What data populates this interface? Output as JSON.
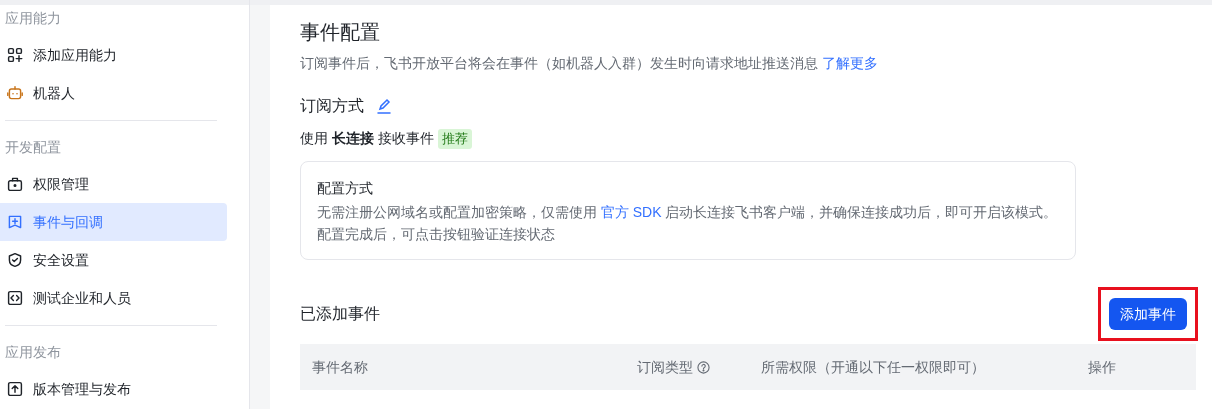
{
  "sidebar": {
    "sections": [
      {
        "title": "应用能力",
        "items": [
          {
            "label": "添加应用能力",
            "kind": "grid-plus",
            "selected": false
          },
          {
            "label": "机器人",
            "kind": "robot",
            "selected": false
          }
        ]
      },
      {
        "title": "开发配置",
        "items": [
          {
            "label": "权限管理",
            "kind": "lock-box",
            "selected": false
          },
          {
            "label": "事件与回调",
            "kind": "plus-flag",
            "selected": true
          },
          {
            "label": "安全设置",
            "kind": "shield",
            "selected": false
          },
          {
            "label": "测试企业和人员",
            "kind": "code-box",
            "selected": false
          }
        ]
      },
      {
        "title": "应用发布",
        "items": [
          {
            "label": "版本管理与发布",
            "kind": "upload-box",
            "selected": false
          }
        ]
      }
    ]
  },
  "page": {
    "title": "事件配置",
    "description": "订阅事件后，飞书开放平台将会在事件（如机器人入群）发生时向请求地址推送消息",
    "learn_more_link": "了解更多",
    "subscription": {
      "heading": "订阅方式",
      "mode_text": "使用 **长连接** 接收事件",
      "badge": "推荐",
      "card": {
        "title": "配置方式",
        "text_before": "无需注册公网域名或配置加密策略，仅需使用",
        "link": "官方 SDK",
        "text_after": "启动长连接飞书客户端，并确保连接成功后，即可开启该模式。配置完成后，可点击按钮验证连接状态"
      }
    },
    "added_events": {
      "heading": "已添加事件",
      "add_button": {
        "label": "添加事件",
        "highlighted": true
      },
      "table": {
        "columns": [
          {
            "label": "事件名称",
            "help": false
          },
          {
            "label": "订阅类型",
            "help": true
          },
          {
            "label": "所需权限（开通以下任一权限即可）",
            "help": false
          },
          {
            "label": "操作",
            "help": false
          }
        ]
      }
    }
  }
}
